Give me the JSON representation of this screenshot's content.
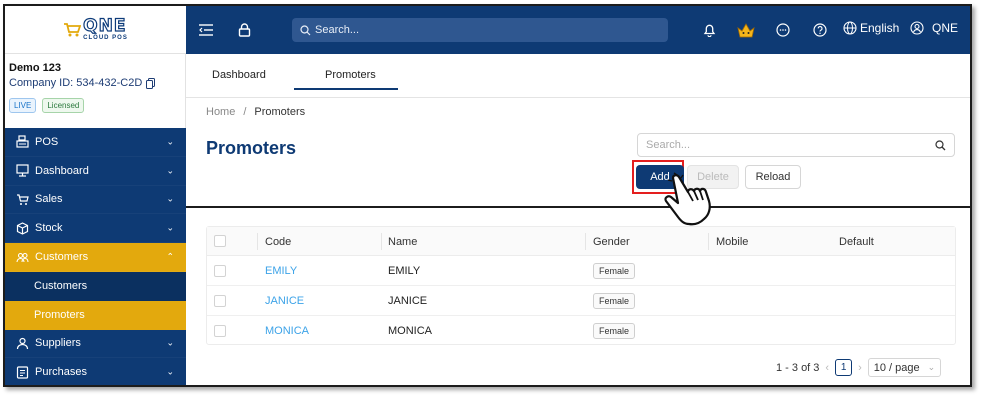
{
  "brand": {
    "logo_main": "QNE",
    "logo_sub": "CLOUD POS"
  },
  "company": {
    "name": "Demo 123",
    "id_label": "Company ID: 534-432-C2D",
    "badge_live": "LIVE",
    "badge_licensed": "Licensed"
  },
  "sidebar": {
    "items": [
      {
        "label": "POS",
        "icon": "register-icon"
      },
      {
        "label": "Dashboard",
        "icon": "monitor-icon"
      },
      {
        "label": "Sales",
        "icon": "cart-icon"
      },
      {
        "label": "Stock",
        "icon": "box-icon"
      },
      {
        "label": "Customers",
        "icon": "group-icon"
      },
      {
        "label": "Customers"
      },
      {
        "label": "Promoters"
      },
      {
        "label": "Suppliers",
        "icon": "person-icon"
      },
      {
        "label": "Purchases",
        "icon": "receipt-icon"
      }
    ]
  },
  "topbar": {
    "search_placeholder": "Search...",
    "language": "English",
    "user": "QNE"
  },
  "tabs": [
    {
      "label": "Dashboard"
    },
    {
      "label": "Promoters"
    }
  ],
  "breadcrumb": {
    "home": "Home",
    "separator": "/",
    "current": "Promoters"
  },
  "page": {
    "title": "Promoters",
    "search_placeholder": "Search..."
  },
  "toolbar": {
    "add_label": "Add",
    "delete_label": "Delete",
    "reload_label": "Reload"
  },
  "table": {
    "columns": [
      "Code",
      "Name",
      "Gender",
      "Mobile",
      "Default"
    ],
    "rows": [
      {
        "code": "EMILY",
        "name": "EMILY",
        "gender": "Female"
      },
      {
        "code": "JANICE",
        "name": "JANICE",
        "gender": "Female"
      },
      {
        "code": "MONICA",
        "name": "MONICA",
        "gender": "Female"
      }
    ]
  },
  "pagination": {
    "range": "1 - 3 of 3",
    "current_page": "1",
    "page_size": "10 / page"
  },
  "colors": {
    "navy": "#0e3a74",
    "accent": "#e3a90d",
    "link": "#3da3e8",
    "highlight": "#e41e1e"
  }
}
